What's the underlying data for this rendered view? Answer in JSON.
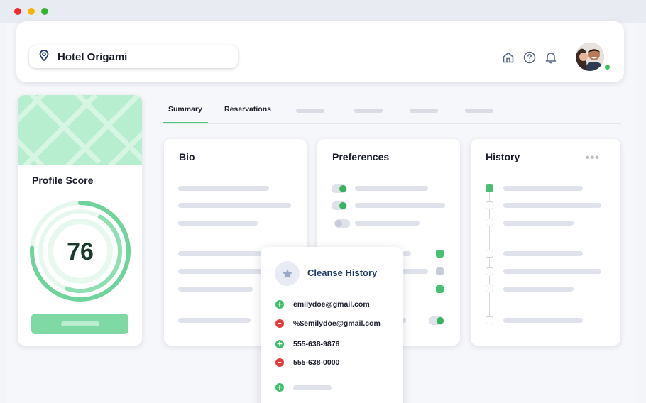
{
  "window": {
    "traffic_lights": [
      "close",
      "minimize",
      "maximize"
    ]
  },
  "header": {
    "hotel_name": "Hotel Origami",
    "icons": [
      "location-pin-icon",
      "home-icon",
      "help-icon",
      "bell-icon"
    ],
    "avatar_status": "online"
  },
  "profile": {
    "title": "Profile Score",
    "score": "76",
    "score_fraction": 0.76
  },
  "tabs": {
    "items": [
      "Summary",
      "Reservations"
    ],
    "active": "Summary"
  },
  "bio": {
    "title": "Bio"
  },
  "preferences": {
    "title": "Preferences"
  },
  "history": {
    "title": "History",
    "more_label": "•••"
  },
  "cleanse_popup": {
    "title": "Cleanse History",
    "entries": [
      {
        "action": "add",
        "text": "emilydoe@gmail.com"
      },
      {
        "action": "remove",
        "text": "%$emilydoe@gmail.com"
      },
      {
        "action": "add",
        "text": "555-638-9876"
      },
      {
        "action": "remove",
        "text": "555-638-0000"
      }
    ]
  },
  "colors": {
    "accent_green": "#47c073",
    "remove_red": "#e23c3c",
    "popup_title_blue": "#1f3a6e",
    "score_ring": "#6fd39c"
  }
}
